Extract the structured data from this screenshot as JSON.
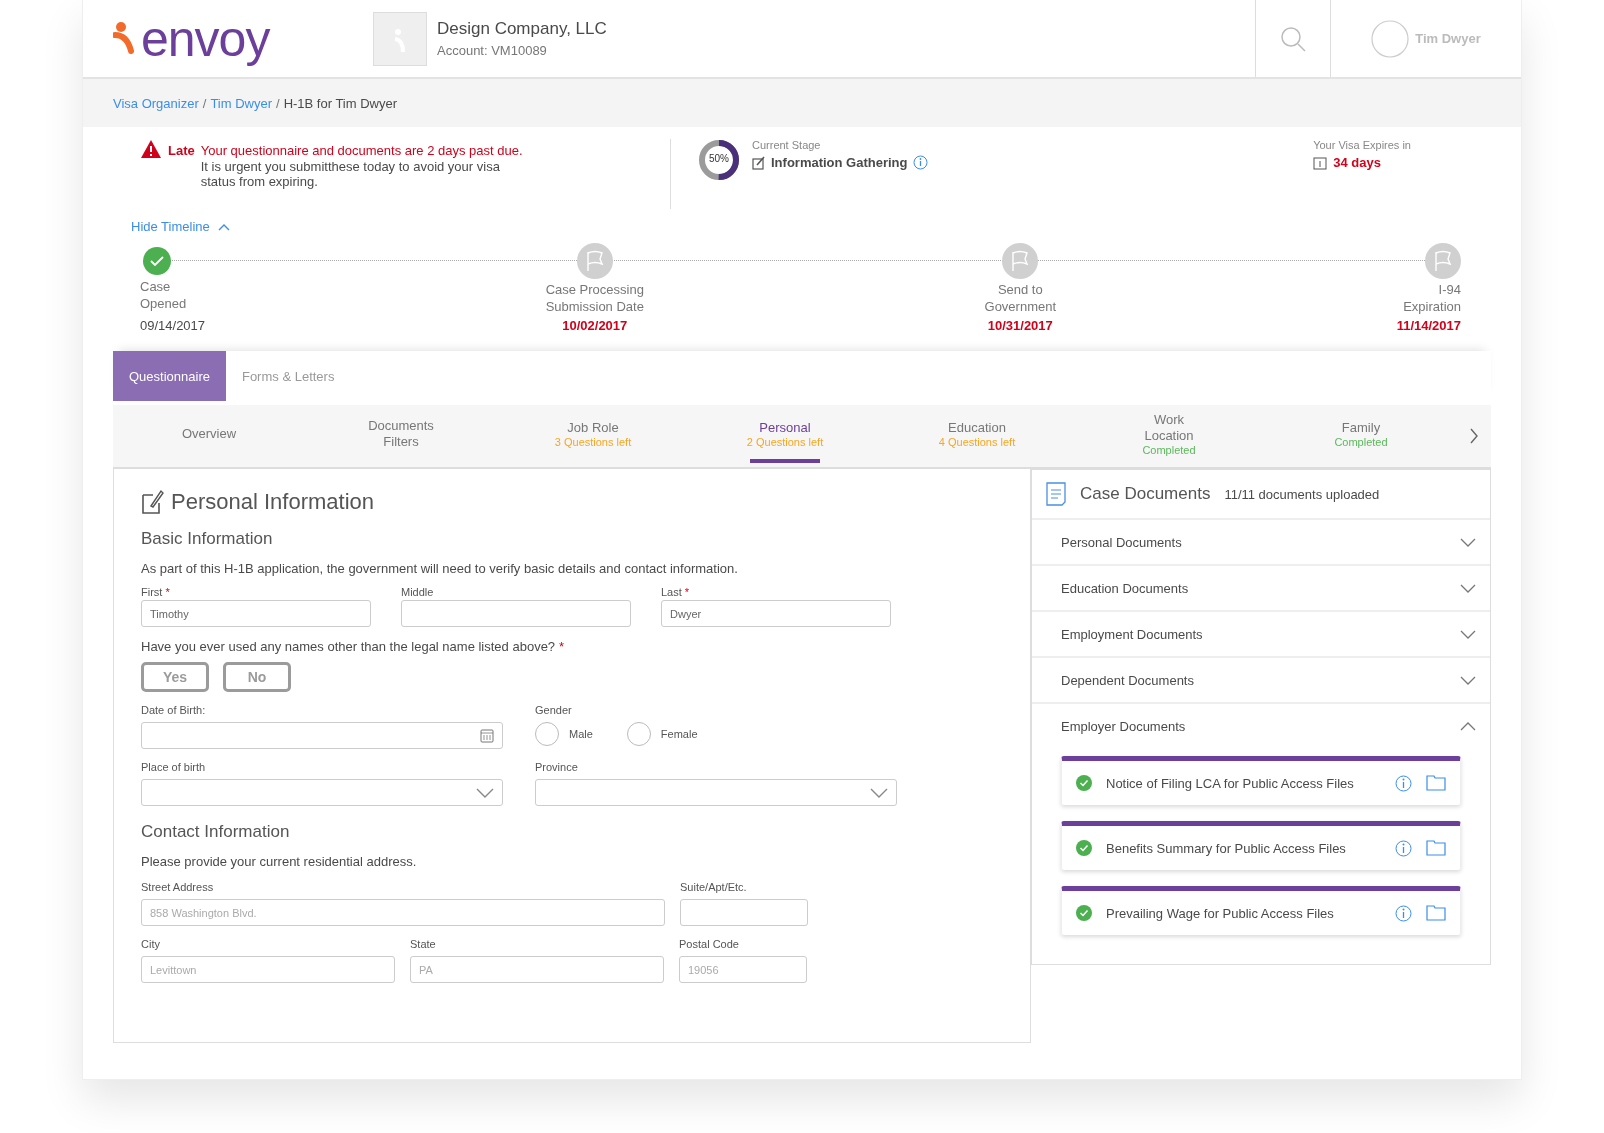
{
  "header": {
    "logo_text": "envoy",
    "company": "Design Company, LLC",
    "account": "Account: VM10089",
    "user": "Tim Dwyer"
  },
  "breadcrumb": {
    "separator": "/",
    "items": [
      {
        "label": "Visa Organizer",
        "link": true
      },
      {
        "label": "Tim Dwyer",
        "link": true
      },
      {
        "label": "H-1B for Tim Dwyer",
        "link": false
      }
    ]
  },
  "alert": {
    "label": "Late",
    "message": "Your questionnaire and documents are 2 days past due.",
    "detail": "It is urgent you submitthese today to avoid your visa status from expiring."
  },
  "stage": {
    "percent": "50%",
    "level": 0.5,
    "caption": "Current Stage",
    "name": "Information Gathering"
  },
  "expiry": {
    "caption": "Your Visa Expires in",
    "value": "34 days"
  },
  "timeline": {
    "toggle": "Hide Timeline",
    "expanded": true,
    "milestones": [
      {
        "lines": [
          "Case",
          "Opened"
        ],
        "date": "09/14/2017",
        "done": true,
        "overdue": false
      },
      {
        "lines": [
          "Case Processing",
          "Submission Date"
        ],
        "date": "10/02/2017",
        "done": false,
        "overdue": true
      },
      {
        "lines": [
          "Send to",
          "Government"
        ],
        "date": "10/31/2017",
        "done": false,
        "overdue": true
      },
      {
        "lines": [
          "I-94",
          "Expiration"
        ],
        "date": "11/14/2017",
        "done": false,
        "overdue": true
      }
    ]
  },
  "main_tabs": [
    {
      "label": "Questionnaire",
      "selected": true
    },
    {
      "label": "Forms & Letters",
      "selected": false
    }
  ],
  "sections": [
    {
      "lines": [
        "Overview"
      ],
      "selected": false
    },
    {
      "lines": [
        "Documents",
        "Filters"
      ],
      "selected": false
    },
    {
      "lines": [
        "Job Role"
      ],
      "status": "3 Questions left",
      "kind": "pending",
      "selected": false
    },
    {
      "lines": [
        "Personal"
      ],
      "status": "2 Questions left",
      "kind": "pending",
      "selected": true
    },
    {
      "lines": [
        "Education"
      ],
      "status": "4 Questions left",
      "kind": "pending",
      "selected": false
    },
    {
      "lines": [
        "Work",
        "Location"
      ],
      "status": "Completed",
      "kind": "completed",
      "selected": false
    },
    {
      "lines": [
        "Family"
      ],
      "status": "Completed",
      "kind": "completed",
      "selected": false
    }
  ],
  "form": {
    "title": "Personal Information",
    "basic": {
      "heading": "Basic Information",
      "intro": "As part of this H-1B application, the government will need to verify basic details and contact information.",
      "names": [
        {
          "label": "First",
          "mark": "*",
          "value": "Timothy"
        },
        {
          "label": "Middle"
        },
        {
          "label": "Last",
          "mark": "*",
          "value": "Dwyer"
        }
      ],
      "other_names": {
        "question": "Have you ever used any names other than the legal name listed above?",
        "mark": "*",
        "options": [
          {
            "label": "Yes",
            "selected": false
          },
          {
            "label": "No",
            "selected": false
          }
        ]
      },
      "birth_date": {
        "label": "Date of Birth:"
      },
      "gender": {
        "label": "Gender",
        "options": [
          {
            "label": "Male",
            "selected": false
          },
          {
            "label": "Female",
            "selected": false
          }
        ]
      },
      "place_of_birth": {
        "label": "Place of birth"
      },
      "province": {
        "label": "Province"
      }
    },
    "contact": {
      "heading": "Contact Information",
      "intro": "Please provide your current residential address.",
      "street": {
        "label": "Street Address",
        "placeholder": "858 Washington Blvd."
      },
      "suite": {
        "label": "Suite/Apt/Etc."
      },
      "city": {
        "label": "City",
        "placeholder": "Levittown"
      },
      "state": {
        "label": "State",
        "placeholder": "PA"
      },
      "postal": {
        "label": "Postal Code",
        "placeholder": "19056"
      }
    }
  },
  "case_documents": {
    "title": "Case Documents",
    "count": "11/11 documents uploaded",
    "groups": [
      {
        "name": "Personal Documents",
        "expanded": false
      },
      {
        "name": "Education Documents",
        "expanded": false
      },
      {
        "name": "Employment Documents",
        "expanded": false
      },
      {
        "name": "Dependent Documents",
        "expanded": false
      },
      {
        "name": "Employer Documents",
        "expanded": true,
        "files": [
          {
            "name": "Notice of Filing LCA for Public Access Files",
            "uploaded": true
          },
          {
            "name": "Benefits Summary for Public Access Files",
            "uploaded": true
          },
          {
            "name": "Prevailing Wage for Public Access Files",
            "uploaded": true
          }
        ]
      }
    ]
  }
}
